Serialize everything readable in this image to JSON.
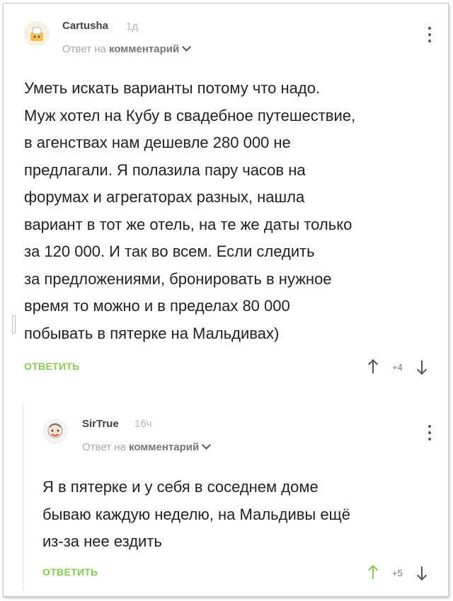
{
  "comments": [
    {
      "author": "Cartusha",
      "time": "1д",
      "reply_prefix": "Ответ на",
      "reply_target": "комментарий",
      "avatar": "cartoon-avatar",
      "body": "Уметь искать варианты потому что надо.\nМуж хотел на Кубу в свадебное путешествие,\nв агенствах нам дешевле 280 000 не\nпредлагали. Я полазила пару часов на\nфорумах и агрегаторах разных, нашла\nвариант в тот же отель, на те же даты только\nза 120 000. И так во всем. Если следить\nза предложениями, бронировать в нужное\nвремя  то можно и в пределах 80 000\nпобывать в пятерке на Мальдивах)",
      "reply_label": "ОТВЕТИТЬ",
      "score": "+4"
    },
    {
      "author": "SirTrue",
      "time": "16ч",
      "reply_prefix": "Ответ на",
      "reply_target": "комментарий",
      "avatar": "cartoon-avatar",
      "body": "Я в пятерке и у себя в соседнем доме\nбываю каждую неделю, на Мальдивы ещё\nиз-за нее ездить",
      "reply_label": "ОТВЕТИТЬ",
      "score": "+5"
    }
  ],
  "colors": {
    "accent": "#8ac858",
    "text": "#222222",
    "muted": "#a9a9a9"
  }
}
